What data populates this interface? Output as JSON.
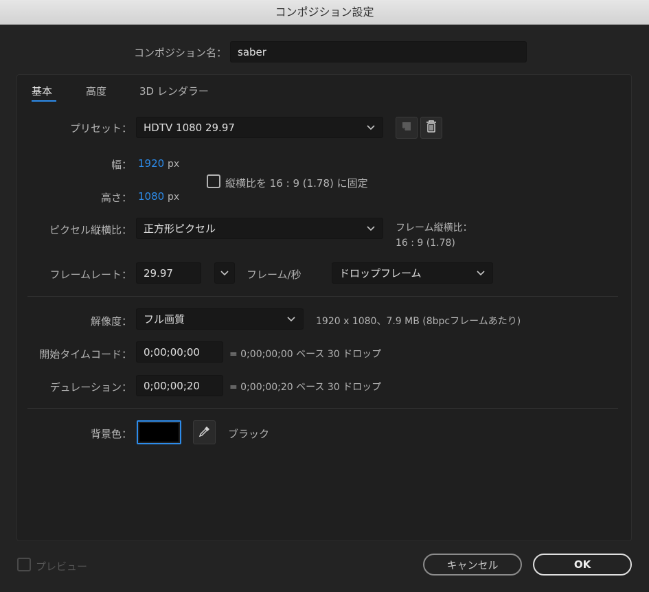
{
  "window": {
    "title": "コンポジション設定"
  },
  "composition_name": {
    "label": "コンポジション名：",
    "value": "saber"
  },
  "tabs": [
    {
      "label": "基本",
      "active": true
    },
    {
      "label": "高度",
      "active": false
    },
    {
      "label": "3D レンダラー",
      "active": false
    }
  ],
  "preset": {
    "label": "プリセット：",
    "value": "HDTV 1080 29.97",
    "save_icon": "save-preset-icon",
    "delete_icon": "trash-icon"
  },
  "width": {
    "label": "幅：",
    "value": "1920",
    "unit": "px"
  },
  "height": {
    "label": "高さ：",
    "value": "1080",
    "unit": "px"
  },
  "lock_aspect": {
    "label": "縦横比を 16 : 9 (1.78) に固定",
    "checked": false
  },
  "pixel_aspect": {
    "label": "ピクセル縦横比：",
    "value": "正方形ピクセル"
  },
  "frame_aspect": {
    "label": "フレーム縦横比：",
    "value": "16 : 9 (1.78)"
  },
  "frame_rate": {
    "label": "フレームレート：",
    "value": "29.97",
    "unit": "フレーム/秒",
    "mode": "ドロップフレーム"
  },
  "resolution": {
    "label": "解像度：",
    "value": "フル画質",
    "info": "1920 x 1080、7.9 MB (8bpcフレームあたり)"
  },
  "start_timecode": {
    "label": "開始タイムコード：",
    "value": "0;00;00;00",
    "info": "= 0;00;00;00  ベース 30  ドロップ"
  },
  "duration": {
    "label": "デュレーション：",
    "value": "0;00;00;20",
    "info": "= 0;00;00;20  ベース 30  ドロップ"
  },
  "background": {
    "label": "背景色：",
    "color": "#000000",
    "name": "ブラック",
    "eyedropper_icon": "eyedropper-icon"
  },
  "preview": {
    "label": "プレビュー",
    "checked": false
  },
  "buttons": {
    "cancel": "キャンセル",
    "ok": "OK"
  },
  "colors": {
    "accent": "#2d8ceb",
    "background": "#232323",
    "field": "#181818"
  }
}
